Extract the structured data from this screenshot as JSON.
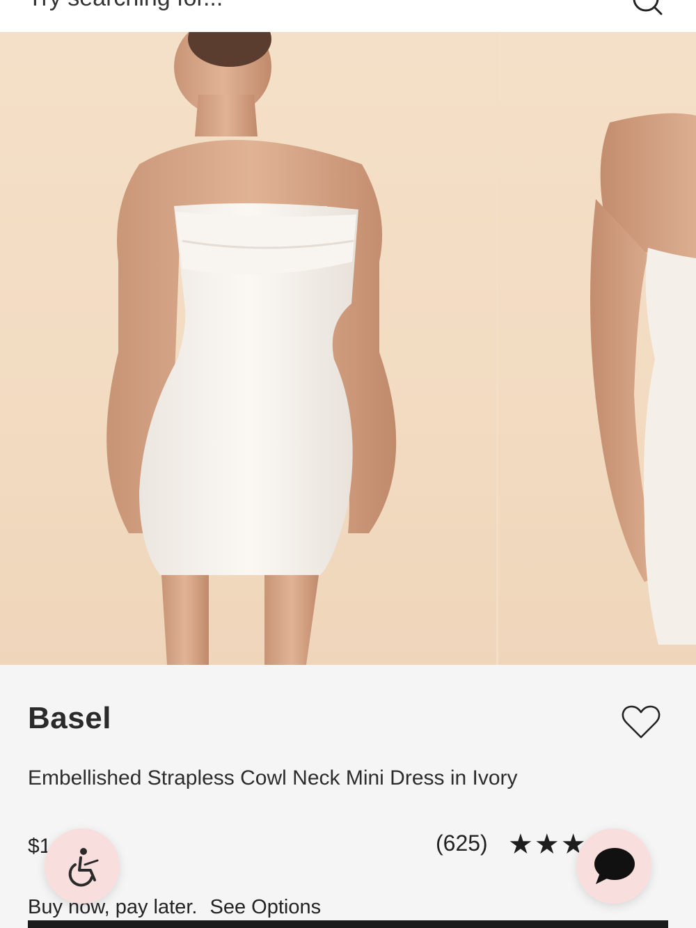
{
  "search": {
    "placeholder": "Try searching for..."
  },
  "gallery": {
    "images": [
      {
        "alt": "front-view"
      },
      {
        "alt": "back-view"
      }
    ]
  },
  "product": {
    "brand": "Basel",
    "name": "Embellished Strapless Cowl Neck Mini Dress in Ivory",
    "price_visible": "$1",
    "review_count": "(625)",
    "stars": "★★★★★",
    "rating_visible_stars": 5,
    "bnpl_text": "Buy now, pay later.",
    "see_options": "See Options"
  },
  "icons": {
    "search": "search-icon",
    "wishlist": "heart-outline-icon",
    "accessibility": "wheelchair-icon",
    "chat": "chat-bubble-icon"
  },
  "colors": {
    "background": "#f5f5f5",
    "photo_backdrop": "#f3dfc7",
    "fab_background": "#f9dede",
    "text": "#222222"
  }
}
